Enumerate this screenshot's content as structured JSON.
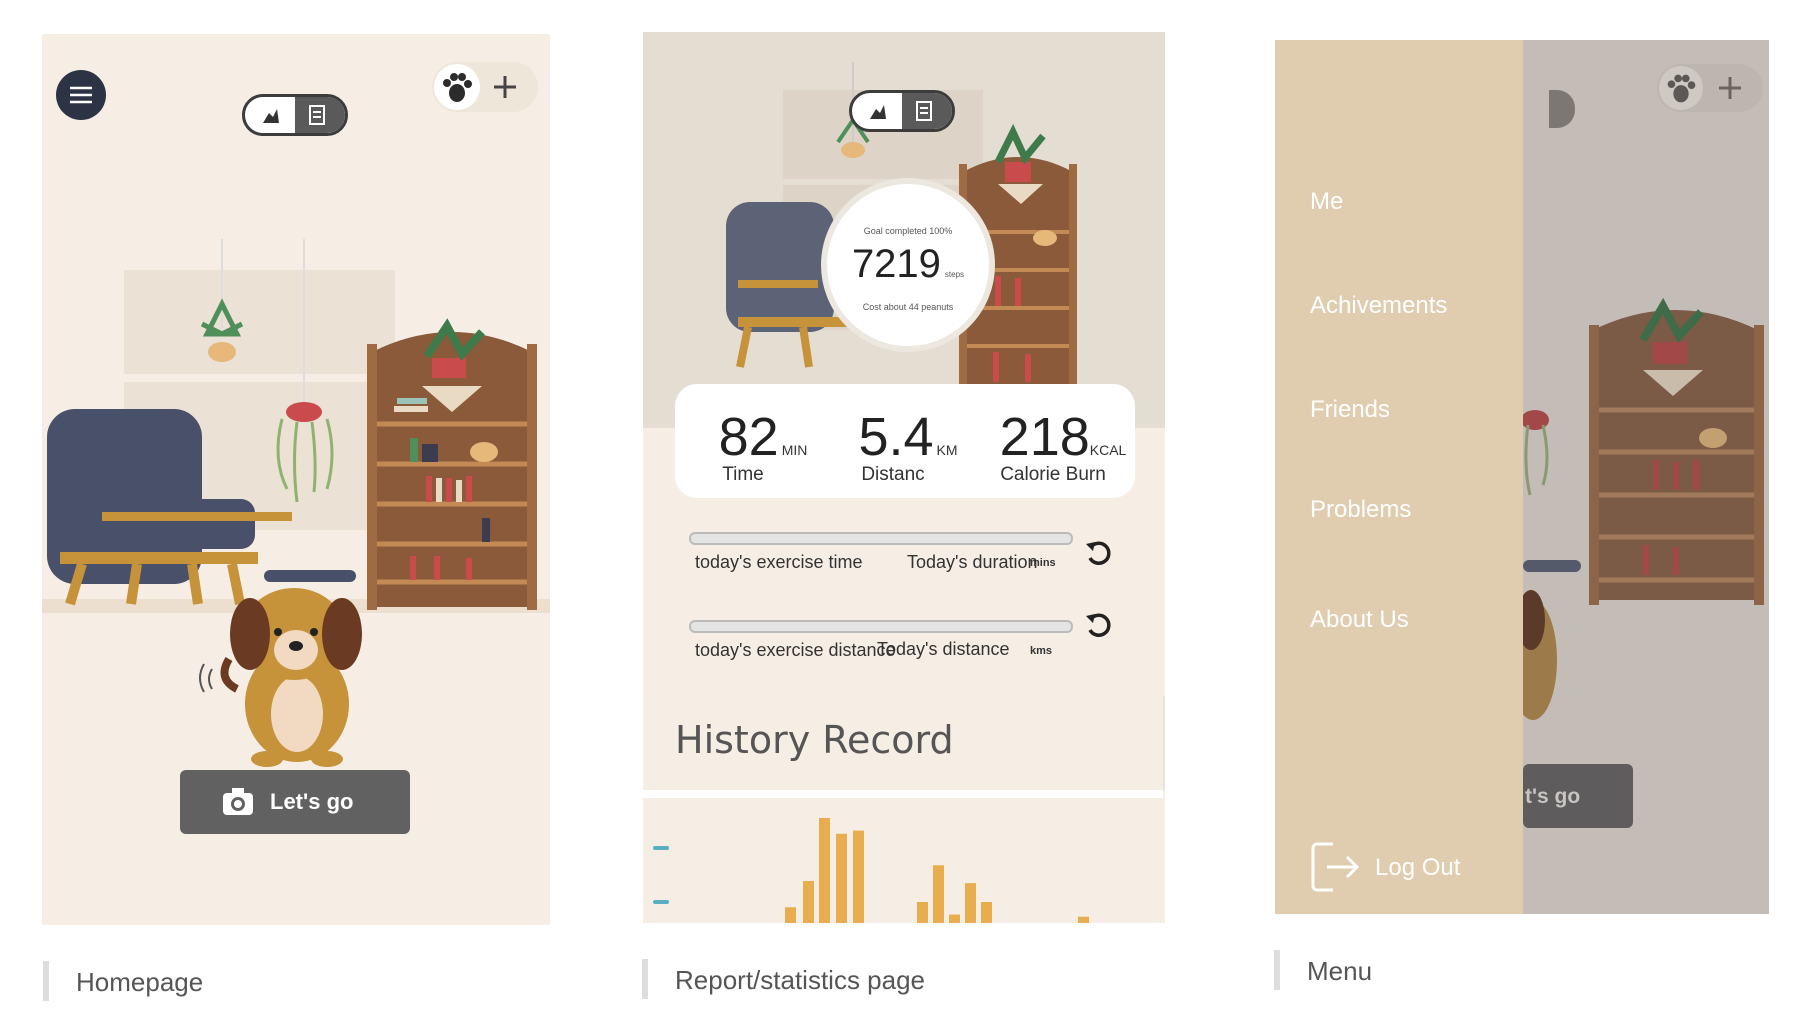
{
  "homepage": {
    "caption": "Homepage",
    "lets_go_label": "Let's go"
  },
  "report": {
    "caption": "Report/statistics page",
    "goal_completed": "Goal completed 100%",
    "steps_value": "7219",
    "steps_unit": "steps",
    "cost_text": "Cost about 44 peanuts",
    "stats": [
      {
        "value": "82",
        "unit": "MIN",
        "label": "Time"
      },
      {
        "value": "5.4",
        "unit": "KM",
        "label": "Distanc"
      },
      {
        "value": "218",
        "unit": "KCAL",
        "label": "Calorie Burn"
      }
    ],
    "progress": [
      {
        "label": "today's exercise time",
        "overlay": "Today's duration",
        "unit": "mins",
        "value_fraction": 0
      },
      {
        "label": "today's exercise distance",
        "overlay": "Today's distance",
        "unit": "kms",
        "value_fraction": 0
      }
    ],
    "history_title": "History Record",
    "history_bars": [
      0.15,
      0.4,
      1.0,
      0.85,
      0.88,
      0.2,
      0.55,
      0.08,
      0.38,
      0.2,
      0.06
    ],
    "colors": {
      "bar": "#e8ad4e",
      "accent": "#5aaec4"
    }
  },
  "menu": {
    "caption": "Menu",
    "items": [
      "Me",
      "Achivements",
      "Friends",
      "Problems",
      "About Us"
    ],
    "logout_label": "Log Out",
    "lets_go_partial": "t's go"
  },
  "colors": {
    "home_bg": "#f6eee4",
    "report_bg": "#e4ddd2",
    "menu_bg": "#e0ccae",
    "chair": "#49506a",
    "shelf": "#8a5a3a",
    "button": "#616161"
  }
}
